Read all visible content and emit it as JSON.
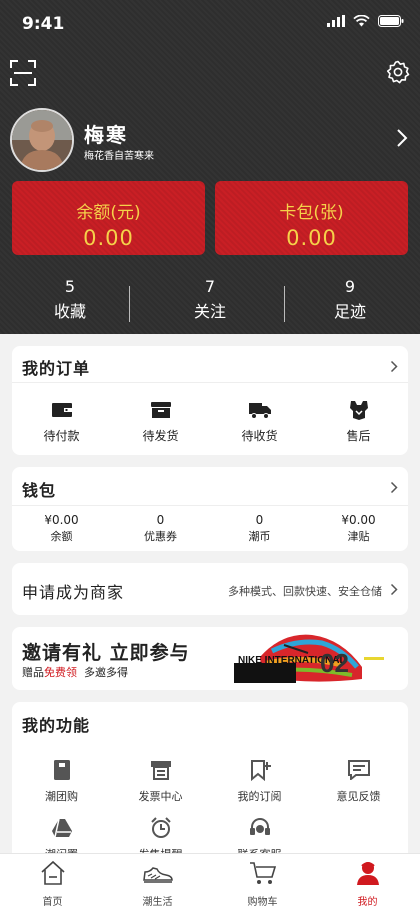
{
  "status": {
    "time": "9:41"
  },
  "profile": {
    "name": "梅寒",
    "subtitle": "梅花香自苦寒来"
  },
  "cards": [
    {
      "label": "余额(元)",
      "value": "0.00"
    },
    {
      "label": "卡包(张)",
      "value": "0.00"
    }
  ],
  "stats": [
    {
      "count": "5",
      "label": "收藏"
    },
    {
      "count": "7",
      "label": "关注"
    },
    {
      "count": "9",
      "label": "足迹"
    }
  ],
  "orders": {
    "title": "我的订单",
    "items": [
      {
        "label": "待付款",
        "icon": "wallet-icon"
      },
      {
        "label": "待发货",
        "icon": "box-icon"
      },
      {
        "label": "待收货",
        "icon": "truck-icon"
      },
      {
        "label": "售后",
        "icon": "service-icon"
      }
    ]
  },
  "wallet": {
    "title": "钱包",
    "items": [
      {
        "value": "¥0.00",
        "label": "余额"
      },
      {
        "value": "0",
        "label": "优惠券"
      },
      {
        "value": "0",
        "label": "潮币"
      },
      {
        "value": "¥0.00",
        "label": "津贴"
      }
    ]
  },
  "merchant": {
    "title": "申请成为商家",
    "subtitle": "多种模式、回款快速、安全仓储"
  },
  "invite": {
    "title": "邀请有礼  立即参与",
    "sub_prefix": "赠品",
    "sub_highlight": "免费领",
    "sub_suffix": "  多邀多得",
    "banner_text": "NIKE INTERNATIONAL",
    "banner_number": "02"
  },
  "functions": {
    "title": "我的功能",
    "items": [
      {
        "label": "潮团购",
        "icon": "phone-icon"
      },
      {
        "label": "发票中心",
        "icon": "invoice-icon"
      },
      {
        "label": "我的订阅",
        "icon": "bookmark-plus-icon"
      },
      {
        "label": "意见反馈",
        "icon": "feedback-icon"
      },
      {
        "label": "潮闲置",
        "icon": "drive-icon"
      },
      {
        "label": "发售提醒",
        "icon": "alarm-clock-icon"
      },
      {
        "label": "联系客服",
        "icon": "headset-icon"
      }
    ]
  },
  "tabbar": {
    "items": [
      {
        "label": "首页",
        "icon": "home-icon"
      },
      {
        "label": "潮生活",
        "icon": "sneaker-icon"
      },
      {
        "label": "购物车",
        "icon": "cart-icon"
      },
      {
        "label": "我的",
        "icon": "person-icon",
        "active": true
      }
    ]
  },
  "colors": {
    "accent": "#c91f25",
    "gold": "#f5d24a",
    "header_bg": "#2e2e2e"
  }
}
